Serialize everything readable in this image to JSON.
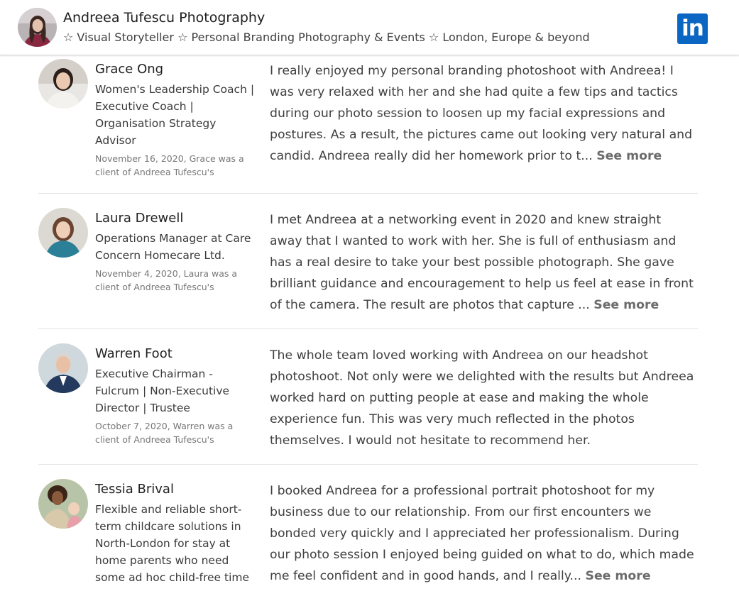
{
  "header": {
    "title": "Andreea Tufescu Photography",
    "subtitle": "☆ Visual Storyteller ☆ Personal Branding Photography & Events ☆ London, Europe & beyond",
    "logo_text": "in",
    "logo_icon": "linkedin-icon",
    "brand_color": "#0a66c2"
  },
  "recommendations": [
    {
      "name": "Grace Ong",
      "headline": "Women's Leadership Coach | Executive Coach | Organisation Strategy Advisor",
      "date": "November 16, 2020, Grace was a client of Andreea Tufescu's",
      "text": "I really enjoyed my personal branding photoshoot with Andreea! I was very relaxed with her and she had quite a few tips and tactics during our photo session to loosen up my facial expressions and postures. As a result, the pictures came out looking very natural and candid. Andreea really did her homework prior to t...",
      "see_more": "See more"
    },
    {
      "name": "Laura Drewell",
      "headline": "Operations Manager at Care Concern Homecare Ltd.",
      "date": "November 4, 2020, Laura was a client of Andreea Tufescu's",
      "text": "I met Andreea at a networking event in 2020 and knew straight away that I wanted to work with her. She is full of enthusiasm and has a real desire to take your best possible photograph. She gave brilliant guidance and encouragement to help us feel at ease in front of the camera. The result are photos that capture ...",
      "see_more": "See more"
    },
    {
      "name": "Warren Foot",
      "headline": "Executive Chairman - Fulcrum | Non-Executive Director | Trustee",
      "date": "October 7, 2020, Warren was a client of Andreea Tufescu's",
      "text": "The whole team loved working with Andreea on our headshot photoshoot. Not only were we delighted with the results but Andreea worked hard on putting people at ease and making the whole experience fun. This was very much reflected in the photos themselves. I would not hesitate to recommend her.",
      "see_more": ""
    },
    {
      "name": "Tessia Brival",
      "headline": "Flexible and reliable short-term childcare solutions in North-London for stay at home parents who need some ad hoc child-free time",
      "date": "",
      "text": "I booked Andreea for a professional portrait photoshoot for my business due to our relationship. From our first encounters we bonded very quickly and I appreciated her professionalism. During our photo session I enjoyed being guided on what to do, which made me feel confident and in good hands, and I really...",
      "see_more": "See more"
    }
  ]
}
